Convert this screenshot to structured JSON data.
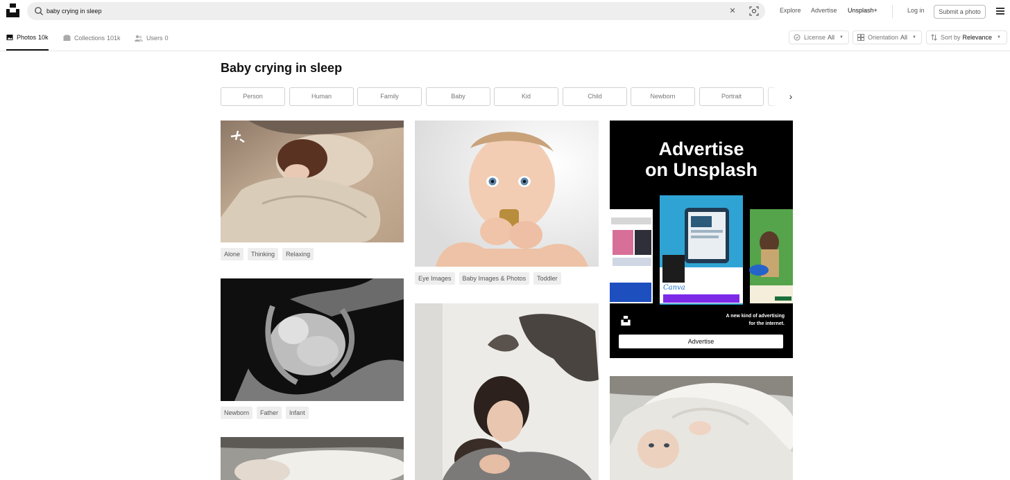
{
  "header": {
    "search_value": "baby crying in sleep",
    "nav": [
      "Explore",
      "Advertise",
      "Unsplash+"
    ],
    "login": "Log in",
    "submit": "Submit a photo"
  },
  "tabs": [
    {
      "label": "Photos",
      "count": "10k"
    },
    {
      "label": "Collections",
      "count": "101k"
    },
    {
      "label": "Users",
      "count": "0"
    }
  ],
  "filters": {
    "license": {
      "label": "License",
      "value": "All"
    },
    "orientation": {
      "label": "Orientation",
      "value": "All"
    },
    "sort": {
      "label": "Sort by",
      "value": "Relevance"
    }
  },
  "page_title": "Baby crying in sleep",
  "related_chips": [
    "Person",
    "Human",
    "Family",
    "Baby",
    "Kid",
    "Child",
    "Newborn",
    "Portrait"
  ],
  "photos": {
    "col1_a": {
      "tags": [
        "Alone",
        "Thinking",
        "Relaxing"
      ]
    },
    "col1_b": {
      "tags": [
        "Newborn",
        "Father",
        "Infant"
      ]
    },
    "col2_a": {
      "tags": [
        "Eye Images",
        "Baby Images & Photos",
        "Toddler"
      ]
    }
  },
  "ad": {
    "title_line1": "Advertise",
    "title_line2": "on Unsplash",
    "tagline_line1": "A new kind of advertising",
    "tagline_line2": "for the internet.",
    "button": "Advertise",
    "brand": "Canva"
  },
  "colors": {
    "accent": "#111111",
    "muted": "#767676",
    "search_bg": "#eeeeee",
    "ad_bg": "#000000",
    "canva_purple": "#7d2ae8"
  }
}
